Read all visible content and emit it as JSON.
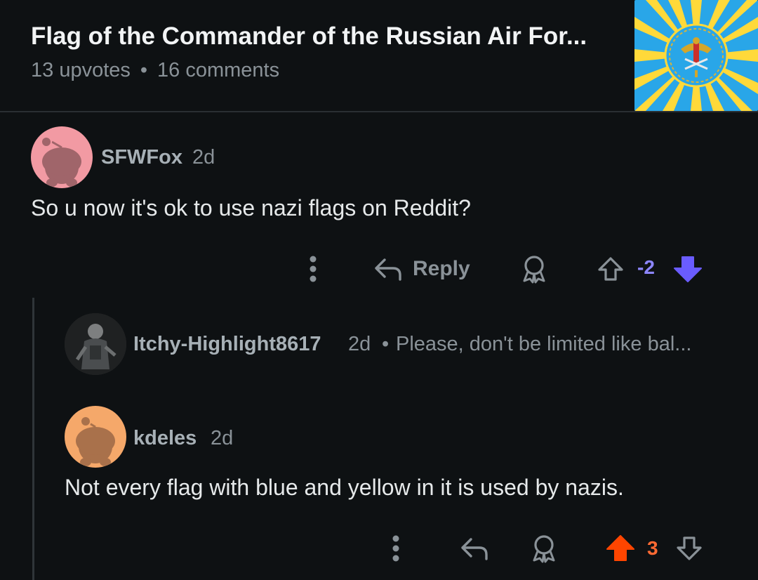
{
  "post": {
    "title": "Flag of the Commander of the Russian Air For...",
    "upvotes": "13 upvotes",
    "separator": "•",
    "comments": "16 comments",
    "thumbnail_icon": "air-force-flag-thumbnail"
  },
  "comments": [
    {
      "username": "SFWFox",
      "age": "2d",
      "text": "So u now it's ok to use nazi flags on Reddit?",
      "reply_label": "Reply",
      "score": "-2",
      "vote_state": "downvoted",
      "avatar_color": "#f29aa3"
    },
    {
      "username": "Itchy-Highlight8617",
      "age": "2d",
      "separator": "•",
      "preview": "Please, don't be limited like bal..."
    },
    {
      "username": "kdeles",
      "age": "2d",
      "text": "Not every flag with blue and yellow in it is used by nazis.",
      "score": "3",
      "vote_state": "upvoted",
      "avatar_color": "#f5a86a"
    }
  ],
  "colors": {
    "background": "#0e1113",
    "downvote": "#6a5cff",
    "upvote": "#ff4500",
    "muted": "#8a9298"
  }
}
